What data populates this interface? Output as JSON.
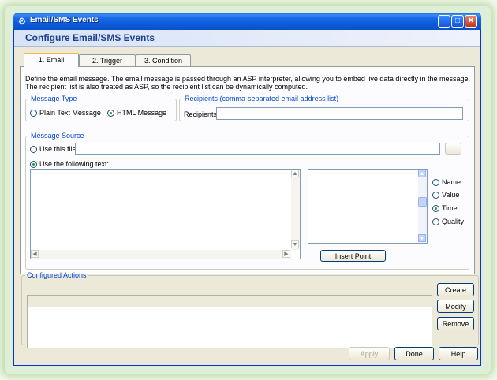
{
  "window": {
    "title": "Email/SMS Events",
    "header": "Configure Email/SMS Events"
  },
  "tabs": [
    {
      "label": "1. Email",
      "active": true
    },
    {
      "label": "2. Trigger",
      "active": false
    },
    {
      "label": "3. Condition",
      "active": false
    }
  ],
  "email": {
    "description": "Define the email message.  The email message is passed through an ASP interpreter, allowing you to embed live data directly in the message.  The recipient list is also treated as ASP, so the recipient list can be dynamically computed.",
    "message_type": {
      "legend": "Message Type",
      "plain_text_label": "Plain Text Message",
      "html_label": "HTML Message",
      "selected": "HTML Message"
    },
    "recipients": {
      "legend": "Recipients (comma-separated email address list)",
      "label": "Recipients:",
      "value": ""
    },
    "message_source": {
      "legend": "Message Source",
      "use_file_label": "Use this file:",
      "file_value": "",
      "browse_label": "...",
      "use_text_label": "Use the following text:",
      "selected": "Use the following text:",
      "text_value": "",
      "insert_point_label": "Insert Point",
      "field_options": [
        "Name",
        "Value",
        "Time",
        "Quality"
      ],
      "field_selected": "Time"
    }
  },
  "configured_actions": {
    "legend": "Configured Actions",
    "create_label": "Create",
    "modify_label": "Modify",
    "remove_label": "Remove"
  },
  "footer": {
    "apply_label": "Apply",
    "done_label": "Done",
    "help_label": "Help"
  },
  "colors": {
    "titlebar": "#0a5ee6",
    "header_text": "#1b3f8f",
    "group_legend": "#0046d5",
    "tab_highlight": "#f7b740"
  }
}
